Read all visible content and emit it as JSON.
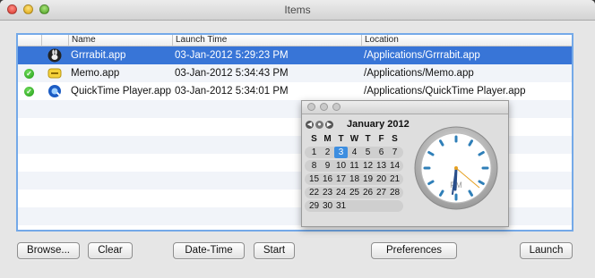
{
  "window": {
    "title": "Items"
  },
  "table": {
    "columns": [
      "Name",
      "Launch Time",
      "Location"
    ],
    "rows": [
      {
        "name": "Grrrabit.app",
        "time": "03-Jan-2012 5:29:23 PM",
        "location": "/Applications/Grrrabit.app",
        "checked": false,
        "selected": true,
        "icon": "rabbit-icon"
      },
      {
        "name": "Memo.app",
        "time": "03-Jan-2012 5:34:43 PM",
        "location": "/Applications/Memo.app",
        "checked": true,
        "selected": false,
        "icon": "memo-icon"
      },
      {
        "name": "QuickTime Player.app",
        "time": "03-Jan-2012 5:34:01 PM",
        "location": "/Applications/QuickTime Player.app",
        "checked": true,
        "selected": false,
        "icon": "quicktime-icon"
      }
    ]
  },
  "buttons": {
    "browse": "Browse...",
    "clear": "Clear",
    "datetime": "Date-Time",
    "start": "Start",
    "preferences": "Preferences",
    "launch": "Launch"
  },
  "calendar": {
    "month_label": "January 2012",
    "weekdays": [
      "S",
      "M",
      "T",
      "W",
      "T",
      "F",
      "S"
    ],
    "weeks": [
      [
        "1",
        "2",
        "3",
        "4",
        "5",
        "6",
        "7"
      ],
      [
        "8",
        "9",
        "10",
        "11",
        "12",
        "13",
        "14"
      ],
      [
        "15",
        "16",
        "17",
        "18",
        "19",
        "20",
        "21"
      ],
      [
        "22",
        "23",
        "24",
        "25",
        "26",
        "27",
        "28"
      ],
      [
        "29",
        "30",
        "31",
        "",
        "",
        "",
        ""
      ]
    ],
    "today": "3",
    "clock_meridiem": "PM",
    "accent_color": "#3d8ee0"
  },
  "colors": {
    "selection": "#3875d7",
    "focus_ring": "#74a9e8"
  }
}
